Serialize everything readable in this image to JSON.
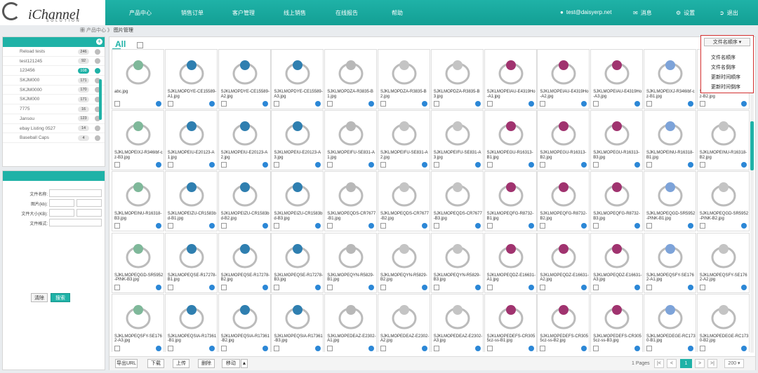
{
  "colors": {
    "accent": "#1fb2a7",
    "selected_outline": "#d32f2f",
    "edit_icon": "#2b87d6"
  },
  "logo": {
    "brand": "iChannel",
    "tagline": "SOLUTION"
  },
  "nav": [
    "产品中心",
    "销售订单",
    "客户管理",
    "线上销售",
    "在线报告",
    "帮助"
  ],
  "user": {
    "email": "test@daisyerp.net",
    "messages": "消息",
    "settings": "设置",
    "logout": "退出"
  },
  "breadcrumb": {
    "home_icon": "grid-icon",
    "parent": "产品中心",
    "sep": "》",
    "current": "图片管理"
  },
  "tags": [
    {
      "label": "Reload tests",
      "count": "246"
    },
    {
      "label": "test121245",
      "count": "92"
    },
    {
      "label": "123456",
      "count": "108",
      "active": true
    },
    {
      "label": "SKJM000",
      "count": "171"
    },
    {
      "label": "SKJM0000",
      "count": "170"
    },
    {
      "label": "SKJM000",
      "count": "171"
    },
    {
      "label": "7775",
      "count": "16"
    },
    {
      "label": "Jansou",
      "count": "123"
    },
    {
      "label": "ebay Listing 0527",
      "count": "14"
    },
    {
      "label": "Baseball Caps",
      "count": "4"
    }
  ],
  "filters": {
    "name_label": "文件名称:",
    "type_label": "图片(kb):",
    "size_label": "文件大小(KB):",
    "format_label": "文件格式:",
    "clear": "清除",
    "search": "搜索"
  },
  "main": {
    "all_label": "All"
  },
  "sort": {
    "button": "文件名顺序",
    "options": [
      "文件名顺序",
      "文件名倒序",
      "更新时间顺序",
      "更新时间倒序"
    ]
  },
  "images": [
    "abc.jpg",
    "SJKLMOPDYE-CE15589-A1.jpg",
    "SJKLMOPDYE-CE15589-A2.jpg",
    "SJKLMOPDYE-CE15589-A3.jpg",
    "SJKLMOPDZA-R3835-B1.jpg",
    "SJKLMOPDZA-R3835-B2.jpg",
    "SJKLMOPDZA-R3835-B3.jpg",
    "SJKLMOPEIAU-E4319Ho-A1.jpg",
    "SJKLMOPEIAU-E4319Ho-A2.jpg",
    "SJKLMOPEIAU-E4319Ho-A3.jpg",
    "SJKLMOPEIXJ-R346Ibf-cz-B1.jpg",
    "SJKLMOPEIXJ-R346Ibf-cz-B2.jpg",
    "SJKLMOPEIXJ-R346Ibf-cz-B3.jpg",
    "SJKLMOPEIU-E20123-A1.jpg",
    "SJKLMOPEIU-E20123-A2.jpg",
    "SJKLMOPEIU-E20123-A3.jpg",
    "SJKLMOPEIFU-SE831-A1.jpg",
    "SJKLMOPEIFU-SE831-A2.jpg",
    "SJKLMOPEIFU-SE831-A3.jpg",
    "SJKLMOPEGU-R16313-B1.jpg",
    "SJKLMOPEGU-R16313-B2.jpg",
    "SJKLMOPEGU-R16313-B3.jpg",
    "SJKLMOPEINU-R16318-B1.jpg",
    "SJKLMOPEINU-R16318-B2.jpg",
    "SJKLMOPEINU-R16318-B3.jpg",
    "SJKLMOPEIZU-CR1583bd-B1.jpg",
    "SJKLMOPEIZU-CR1583bd-B2.jpg",
    "SJKLMOPEIZU-CR1583bd-B3.jpg",
    "SJKLMOPEQDS-CR7677-B1.jpg",
    "SJKLMOPEQDS-CR7677-B2.jpg",
    "SJKLMOPEQDS-CR7677-B3.jpg",
    "SJKLMOPEQFG-R8732-B1.jpg",
    "SJKLMOPEQFG-R8732-B2.jpg",
    "SJKLMOPEQFG-R8732-B3.jpg",
    "SJKLMOPEQGD-SR5952-PINK-B1.jpg",
    "SJKLMOPEQGD-SR5952-PINK-B2.jpg",
    "SJKLMOPEQGD-SR5952-PINK-B3.jpg",
    "SJKLMOPEQSE-R17278-B1.jpg",
    "SJKLMOPEQSE-R17278-B2.jpg",
    "SJKLMOPEQSE-R17278-B3.jpg",
    "SJKLMOPEQYN-R5829-B1.jpg",
    "SJKLMOPEQYN-R5829-B2.jpg",
    "SJKLMOPEQYN-R5829-B3.jpg",
    "SJKLMOPEQDZ-E16631-A1.jpg",
    "SJKLMOPEQDZ-E16631-A2.jpg",
    "SJKLMOPEQDZ-E16631-A3.jpg",
    "SJKLMOPEQSFY-SE1762-A1.jpg",
    "SJKLMOPEQSFY-SE1762-A2.jpg",
    "SJKLMOPEQSFY-SE1762-A3.jpg",
    "SJKLMOPEQSIA-R17361-B1.jpg",
    "SJKLMOPEQSIA-R17361-B2.jpg",
    "SJKLMOPEQSIA-R17361-B3.jpg",
    "SJKLMOPEDEAZ-E2302-A1.jpg",
    "SJKLMOPEDEAZ-E2302-A2.jpg",
    "SJKLMOPEDEAZ-E2302-A3.jpg",
    "SJKLMOPEDEFS-CR3055cz-ss-B1.jpg",
    "SJKLMOPEDEFS-CR3055cz-ss-B2.jpg",
    "SJKLMOPEDEFS-CR3055cz-ss-B3.jpg",
    "SJKLMOPEDEGE-RC1730-B1.jpg",
    "SJKLMOPEDEGE-RC1730-B2.jpg"
  ],
  "bottom": {
    "export_url": "导出URL",
    "download": "下载",
    "upload": "上传",
    "delete": "删除",
    "move": "移动",
    "pages_label": "1 Pages",
    "first": "|<",
    "prev": "<",
    "current": "1",
    "next": ">",
    "last": ">|",
    "per_page": "200"
  }
}
